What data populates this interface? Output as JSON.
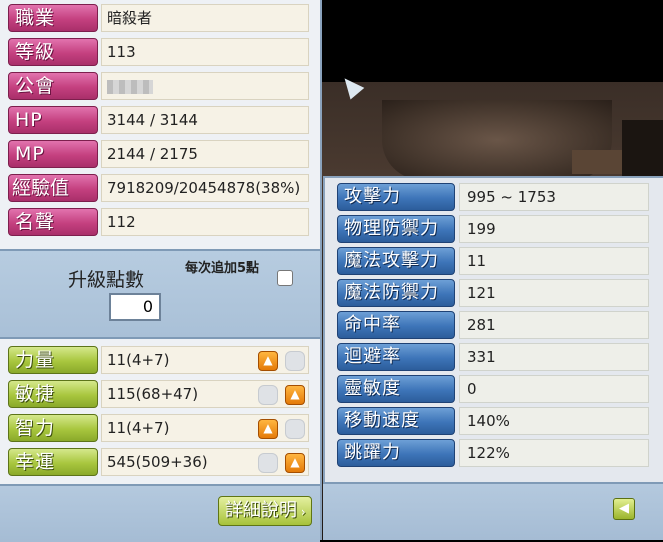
{
  "profile": [
    {
      "label": "職業",
      "value": "暗殺者"
    },
    {
      "label": "等級",
      "value": "113"
    },
    {
      "label": "公會",
      "value": ""
    },
    {
      "label": "HP",
      "value": "3144 / 3144"
    },
    {
      "label": "MP",
      "value": "2144 / 2175"
    },
    {
      "label": "經驗值",
      "value": "7918209/20454878(38%)"
    },
    {
      "label": "名聲",
      "value": "112"
    }
  ],
  "ability_points": {
    "label": "升級點數",
    "value": "0",
    "auto_add_hint": "每次追加5點"
  },
  "stats": [
    {
      "label": "力量",
      "value": "11(4+7)"
    },
    {
      "label": "敏捷",
      "value": "115(68+47)"
    },
    {
      "label": "智力",
      "value": "11(4+7)"
    },
    {
      "label": "幸運",
      "value": "545(509+36)"
    }
  ],
  "detail_button": "詳細說明",
  "detail_stats": [
    {
      "label": "攻擊力",
      "value": "995 ~ 1753"
    },
    {
      "label": "物理防禦力",
      "value": "199"
    },
    {
      "label": "魔法攻擊力",
      "value": "11"
    },
    {
      "label": "魔法防禦力",
      "value": "121"
    },
    {
      "label": "命中率",
      "value": "281"
    },
    {
      "label": "迴避率",
      "value": "331"
    },
    {
      "label": "靈敏度",
      "value": "0"
    },
    {
      "label": "移動速度",
      "value": "140%"
    },
    {
      "label": "跳躍力",
      "value": "122%"
    }
  ],
  "icons": {
    "increase": "arrow-up-icon",
    "back": "arrow-left-icon"
  },
  "colors": {
    "profile_label": "#c4407f",
    "stat_label": "#a8c63e",
    "detail_label": "#3d74b8",
    "add_button": "#f08a10"
  }
}
